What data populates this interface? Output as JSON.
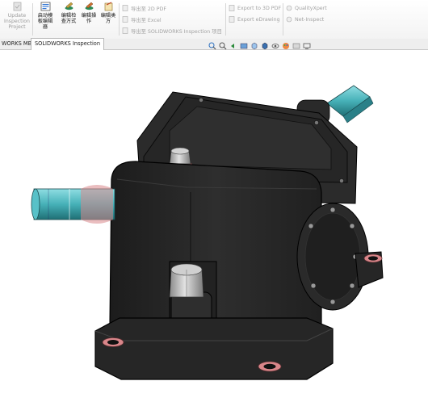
{
  "ribbon": {
    "buttons": [
      {
        "label": "Update\nInspection\nProject",
        "state": "disabled"
      },
      {
        "label": "启动模\n板编辑\n器",
        "state": "enabled"
      },
      {
        "label": "编辑检\n查方式",
        "state": "enabled"
      },
      {
        "label": "编辑操\n作",
        "state": "enabled"
      },
      {
        "label": "编辑类\n方",
        "state": "enabled"
      }
    ],
    "export_2d_pdf": "导出至 2D PDF",
    "export_excel": "导出至 Excel",
    "export_sw_inspection": "导出至 SOLIDWORKS Inspection 项目",
    "export_3d_pdf": "Export to 3D PDF",
    "export_edrawing": "Export eDrawing",
    "qualityxpert": "QualityXpert",
    "net_inspect": "Net-Inspect"
  },
  "tabs": [
    {
      "label": "WORKS MBD",
      "active": false
    },
    {
      "label": "SOLIDWORKS Inspection",
      "active": true
    }
  ],
  "hud_icons": [
    "zoom-to-fit-icon",
    "zoom-area-icon",
    "previous-view-icon",
    "section-view-icon",
    "view-orientation-icon",
    "display-style-icon",
    "hide-show-icon",
    "edit-appearance-icon",
    "scene-icon",
    "view-settings-icon"
  ],
  "colors": {
    "body": "#2a2a2a",
    "shaft": "#4fb8bf",
    "bolt_ring": "#d9868a",
    "bolt": "#bdbdbd"
  }
}
